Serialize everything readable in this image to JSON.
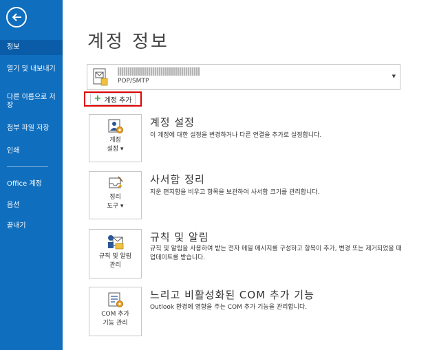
{
  "sidebar": {
    "items": [
      {
        "label": "정보"
      },
      {
        "label": "열기 및 내보내기"
      },
      {
        "label": "다른 이름으로 저장"
      },
      {
        "label": "첨부 파일 저장"
      },
      {
        "label": "인쇄"
      },
      {
        "label": "Office 계정"
      },
      {
        "label": "옵션"
      },
      {
        "label": "끝내기"
      }
    ],
    "selected": "정보",
    "accent_color": "#106ebe",
    "selected_color": "#0a5ca8"
  },
  "main": {
    "title": "계정 정보",
    "account": {
      "name": "",
      "type": "POP/SMTP"
    },
    "add_account_label": "계정 추가",
    "sections": [
      {
        "tile_label": "계정\n설정 ▾",
        "title": "계정 설정",
        "description": "이 계정에 대한 설정을 변경하거나 다른 연결을 추가로 설정합니다.",
        "icon": "account-settings-icon"
      },
      {
        "tile_label": "정리\n도구 ▾",
        "title": "사서함 정리",
        "description": "지운 편지함을 비우고 항목을 보관하여 사서함 크기를 관리합니다.",
        "icon": "cleanup-tools-icon"
      },
      {
        "tile_label": "규칙 및 알림\n관리",
        "title": "규칙 및 알림",
        "description": "규칙 및 알림을 사용하여 받는 전자 메일 메시지를 구성하고 항목이 추가, 변경 또는 제거되었을 때 업데이트를 받습니다.",
        "icon": "rules-alerts-icon"
      },
      {
        "tile_label": "COM 추가\n기능 관리",
        "title": "느리고 비활성화된 COM 추가 기능",
        "description": "Outlook 환경에 영향을 주는 COM 추가 기능을 관리합니다.",
        "icon": "com-addins-icon"
      }
    ]
  }
}
